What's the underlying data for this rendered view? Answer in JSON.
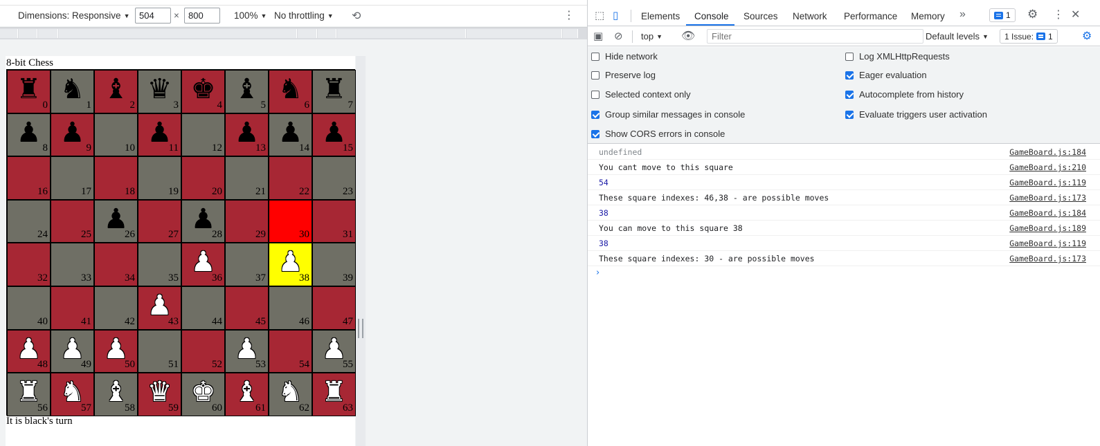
{
  "device_toolbar": {
    "dimensions_label": "Dimensions: Responsive",
    "width_value": "504",
    "times": "×",
    "height_value": "800",
    "zoom": "100%",
    "throttling": "No throttling",
    "rotate_icon": "rotate-icon",
    "more_icon": "more-vertical-icon"
  },
  "page": {
    "title": "8-bit Chess",
    "turn_text": "It is black's turn",
    "board": [
      {
        "i": "0",
        "p": "♜",
        "c": "black",
        "bg": "#a72734"
      },
      {
        "i": "1",
        "p": "♞",
        "c": "black",
        "bg": "#6f6f65"
      },
      {
        "i": "2",
        "p": "♝",
        "c": "black",
        "bg": "#a72734"
      },
      {
        "i": "3",
        "p": "♛",
        "c": "black",
        "bg": "#6f6f65"
      },
      {
        "i": "4",
        "p": "♚",
        "c": "black",
        "bg": "#a72734"
      },
      {
        "i": "5",
        "p": "♝",
        "c": "black",
        "bg": "#6f6f65"
      },
      {
        "i": "6",
        "p": "♞",
        "c": "black",
        "bg": "#a72734"
      },
      {
        "i": "7",
        "p": "♜",
        "c": "black",
        "bg": "#6f6f65"
      },
      {
        "i": "8",
        "p": "♟",
        "c": "black",
        "bg": "#6f6f65"
      },
      {
        "i": "9",
        "p": "♟",
        "c": "black",
        "bg": "#a72734"
      },
      {
        "i": "10",
        "p": "",
        "c": "black",
        "bg": "#6f6f65"
      },
      {
        "i": "11",
        "p": "♟",
        "c": "black",
        "bg": "#a72734"
      },
      {
        "i": "12",
        "p": "",
        "c": "black",
        "bg": "#6f6f65"
      },
      {
        "i": "13",
        "p": "♟",
        "c": "black",
        "bg": "#a72734"
      },
      {
        "i": "14",
        "p": "♟",
        "c": "black",
        "bg": "#6f6f65"
      },
      {
        "i": "15",
        "p": "♟",
        "c": "black",
        "bg": "#a72734"
      },
      {
        "i": "16",
        "p": "",
        "c": "black",
        "bg": "#a72734"
      },
      {
        "i": "17",
        "p": "",
        "c": "black",
        "bg": "#6f6f65"
      },
      {
        "i": "18",
        "p": "",
        "c": "black",
        "bg": "#a72734"
      },
      {
        "i": "19",
        "p": "",
        "c": "black",
        "bg": "#6f6f65"
      },
      {
        "i": "20",
        "p": "",
        "c": "black",
        "bg": "#a72734"
      },
      {
        "i": "21",
        "p": "",
        "c": "black",
        "bg": "#6f6f65"
      },
      {
        "i": "22",
        "p": "",
        "c": "black",
        "bg": "#a72734"
      },
      {
        "i": "23",
        "p": "",
        "c": "black",
        "bg": "#6f6f65"
      },
      {
        "i": "24",
        "p": "",
        "c": "black",
        "bg": "#6f6f65"
      },
      {
        "i": "25",
        "p": "",
        "c": "black",
        "bg": "#a72734"
      },
      {
        "i": "26",
        "p": "♟",
        "c": "black",
        "bg": "#6f6f65"
      },
      {
        "i": "27",
        "p": "",
        "c": "black",
        "bg": "#a72734"
      },
      {
        "i": "28",
        "p": "♟",
        "c": "black",
        "bg": "#6f6f65"
      },
      {
        "i": "29",
        "p": "",
        "c": "black",
        "bg": "#a72734"
      },
      {
        "i": "30",
        "p": "",
        "c": "black",
        "bg": "#ff0000"
      },
      {
        "i": "31",
        "p": "",
        "c": "black",
        "bg": "#a72734"
      },
      {
        "i": "32",
        "p": "",
        "c": "black",
        "bg": "#a72734"
      },
      {
        "i": "33",
        "p": "",
        "c": "black",
        "bg": "#6f6f65"
      },
      {
        "i": "34",
        "p": "",
        "c": "black",
        "bg": "#a72734"
      },
      {
        "i": "35",
        "p": "",
        "c": "black",
        "bg": "#6f6f65"
      },
      {
        "i": "36",
        "p": "♟",
        "c": "white",
        "bg": "#a72734"
      },
      {
        "i": "37",
        "p": "",
        "c": "black",
        "bg": "#6f6f65"
      },
      {
        "i": "38",
        "p": "♟",
        "c": "white",
        "bg": "#ffff00"
      },
      {
        "i": "39",
        "p": "",
        "c": "black",
        "bg": "#6f6f65"
      },
      {
        "i": "40",
        "p": "",
        "c": "black",
        "bg": "#6f6f65"
      },
      {
        "i": "41",
        "p": "",
        "c": "black",
        "bg": "#a72734"
      },
      {
        "i": "42",
        "p": "",
        "c": "black",
        "bg": "#6f6f65"
      },
      {
        "i": "43",
        "p": "♟",
        "c": "white",
        "bg": "#a72734"
      },
      {
        "i": "44",
        "p": "",
        "c": "black",
        "bg": "#6f6f65"
      },
      {
        "i": "45",
        "p": "",
        "c": "black",
        "bg": "#a72734"
      },
      {
        "i": "46",
        "p": "",
        "c": "black",
        "bg": "#6f6f65"
      },
      {
        "i": "47",
        "p": "",
        "c": "black",
        "bg": "#a72734"
      },
      {
        "i": "48",
        "p": "♟",
        "c": "white",
        "bg": "#a72734"
      },
      {
        "i": "49",
        "p": "♟",
        "c": "white",
        "bg": "#6f6f65"
      },
      {
        "i": "50",
        "p": "♟",
        "c": "white",
        "bg": "#a72734"
      },
      {
        "i": "51",
        "p": "",
        "c": "black",
        "bg": "#6f6f65"
      },
      {
        "i": "52",
        "p": "",
        "c": "black",
        "bg": "#a72734"
      },
      {
        "i": "53",
        "p": "♟",
        "c": "white",
        "bg": "#6f6f65"
      },
      {
        "i": "54",
        "p": "",
        "c": "black",
        "bg": "#a72734"
      },
      {
        "i": "55",
        "p": "♟",
        "c": "white",
        "bg": "#6f6f65"
      },
      {
        "i": "56",
        "p": "♜",
        "c": "white",
        "bg": "#6f6f65"
      },
      {
        "i": "57",
        "p": "♞",
        "c": "white",
        "bg": "#a72734"
      },
      {
        "i": "58",
        "p": "♝",
        "c": "white",
        "bg": "#6f6f65"
      },
      {
        "i": "59",
        "p": "♛",
        "c": "white",
        "bg": "#a72734"
      },
      {
        "i": "60",
        "p": "♚",
        "c": "white",
        "bg": "#6f6f65"
      },
      {
        "i": "61",
        "p": "♝",
        "c": "white",
        "bg": "#a72734"
      },
      {
        "i": "62",
        "p": "♞",
        "c": "white",
        "bg": "#6f6f65"
      },
      {
        "i": "63",
        "p": "♜",
        "c": "white",
        "bg": "#a72734"
      }
    ]
  },
  "devtools": {
    "tabs": [
      "Elements",
      "Console",
      "Sources",
      "Network",
      "Performance",
      "Memory"
    ],
    "active_tab": "Console",
    "messages_badge": "1",
    "console_toolbar": {
      "context": "top",
      "filter_placeholder": "Filter",
      "levels": "Default levels",
      "issues": "1 Issue:",
      "issues_count": "1"
    },
    "settings_left": [
      {
        "label": "Hide network",
        "checked": false
      },
      {
        "label": "Preserve log",
        "checked": false
      },
      {
        "label": "Selected context only",
        "checked": false
      },
      {
        "label": "Group similar messages in console",
        "checked": true
      },
      {
        "label": "Show CORS errors in console",
        "checked": true
      }
    ],
    "settings_right": [
      {
        "label": "Log XMLHttpRequests",
        "checked": false
      },
      {
        "label": "Eager evaluation",
        "checked": true
      },
      {
        "label": "Autocomplete from history",
        "checked": true
      },
      {
        "label": "Evaluate triggers user activation",
        "checked": true
      }
    ],
    "log": [
      {
        "text": "undefined",
        "kind": "gray",
        "source": "GameBoard.js:184"
      },
      {
        "text": "You cant move to this square",
        "kind": "text",
        "source": "GameBoard.js:210"
      },
      {
        "text": "54",
        "kind": "num",
        "source": "GameBoard.js:119"
      },
      {
        "text": "These square indexes: 46,38 - are possible moves",
        "kind": "text",
        "source": "GameBoard.js:173"
      },
      {
        "text": "38",
        "kind": "num",
        "source": "GameBoard.js:184"
      },
      {
        "text": "You can move to this square 38",
        "kind": "text",
        "source": "GameBoard.js:189"
      },
      {
        "text": "38",
        "kind": "num",
        "source": "GameBoard.js:119"
      },
      {
        "text": "These square indexes: 30 - are possible moves",
        "kind": "text",
        "source": "GameBoard.js:173"
      }
    ],
    "prompt": "›"
  }
}
